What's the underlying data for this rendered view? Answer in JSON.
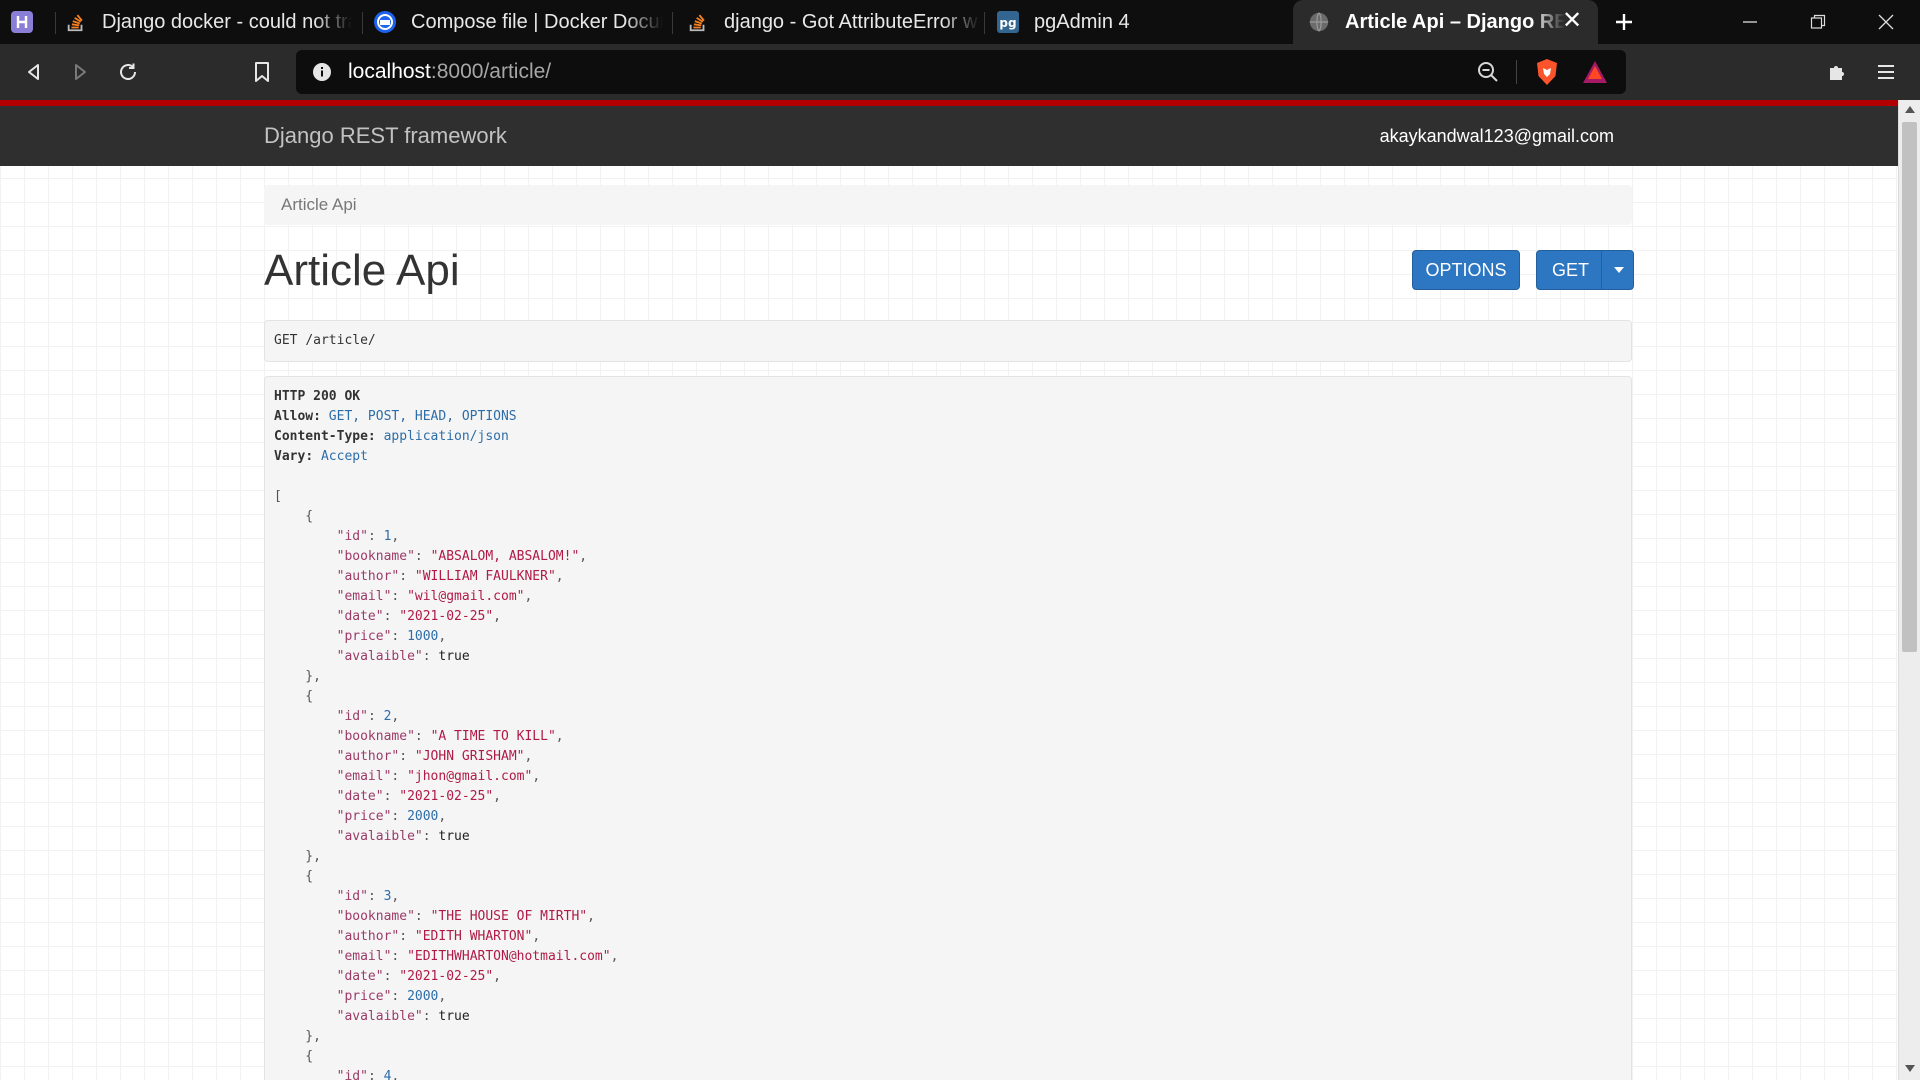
{
  "browser": {
    "tabs": [
      {
        "title": "Django docker - could not translate host name",
        "icon": "stackoverflow-icon",
        "active": false
      },
      {
        "title": "Compose file | Docker Documentation",
        "icon": "docker-icon",
        "active": false
      },
      {
        "title": "django - Got AttributeError when attempting",
        "icon": "stackoverflow-icon",
        "active": false
      },
      {
        "title": "pgAdmin 4",
        "icon": "pgadmin-icon",
        "active": false
      },
      {
        "title": "Article Api – Django REST framework",
        "icon": "globe-icon",
        "active": true
      }
    ],
    "pinned_tab_icon": "hackerrank-icon",
    "url": {
      "host": "localhost",
      "rest": ":8000/article/"
    },
    "colors": {
      "accent_red": "#b20000",
      "tab_bg": "#0e0e0e",
      "toolbar_bg": "#2b2b2b"
    }
  },
  "navbar": {
    "brand": "Django REST framework",
    "user": "akaykandwal123@gmail.com"
  },
  "breadcrumb": "Article Api",
  "page_title": "Article Api",
  "buttons": {
    "options": "OPTIONS",
    "get": "GET",
    "primary_color": "#2d76c2"
  },
  "request": {
    "method": "GET",
    "path": "/article/"
  },
  "response": {
    "status": "HTTP 200 OK",
    "headers": [
      {
        "key": "Allow",
        "value": "GET, POST, HEAD, OPTIONS"
      },
      {
        "key": "Content-Type",
        "value": "application/json"
      },
      {
        "key": "Vary",
        "value": "Accept"
      }
    ],
    "items": [
      {
        "id": "1",
        "bookname": "\"ABSALOM, ABSALOM!\"",
        "author": "\"WILLIAM FAULKNER\"",
        "email": "\"wil@gmail.com\"",
        "date": "\"2021-02-25\"",
        "price": "1000",
        "avalaible": "true"
      },
      {
        "id": "2",
        "bookname": "\"A TIME TO KILL\"",
        "author": "\"JOHN GRISHAM\"",
        "email": "\"jhon@gmail.com\"",
        "date": "\"2021-02-25\"",
        "price": "2000",
        "avalaible": "true"
      },
      {
        "id": "3",
        "bookname": "\"THE HOUSE OF MIRTH\"",
        "author": "\"EDITH WHARTON\"",
        "email": "\"EDITHWHARTON@hotmail.com\"",
        "date": "\"2021-02-25\"",
        "price": "2000",
        "avalaible": "true"
      }
    ],
    "partial_next_id": "4"
  }
}
